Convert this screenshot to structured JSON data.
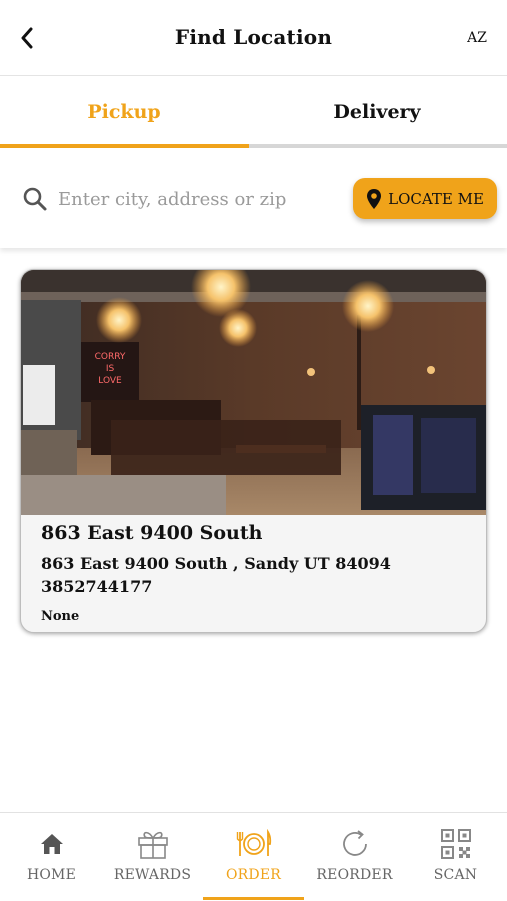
{
  "header": {
    "title": "Find Location",
    "language": "AZ"
  },
  "tabs": [
    {
      "label": "Pickup",
      "active": true
    },
    {
      "label": "Delivery",
      "active": false
    }
  ],
  "search": {
    "placeholder": "Enter city, address or zip",
    "value": "",
    "locate_label": "LOCATE ME"
  },
  "location_card": {
    "name": "863 East 9400 South",
    "address": "863 East 9400 South , Sandy UT 84094",
    "phone": "3852744177",
    "note": "None",
    "photo_sign_text": [
      "CORRY",
      "IS",
      "LOVE"
    ]
  },
  "bottom_nav": [
    {
      "label": "HOME",
      "icon": "home-icon",
      "active": false
    },
    {
      "label": "REWARDS",
      "icon": "gift-icon",
      "active": false
    },
    {
      "label": "ORDER",
      "icon": "plate-utensils-icon",
      "active": true
    },
    {
      "label": "REORDER",
      "icon": "refresh-icon",
      "active": false
    },
    {
      "label": "SCAN",
      "icon": "qr-code-icon",
      "active": false
    }
  ],
  "colors": {
    "accent": "#f0a31a",
    "inactive_tab_line": "#d7d7d7",
    "card_bg": "#f5f5f5"
  }
}
